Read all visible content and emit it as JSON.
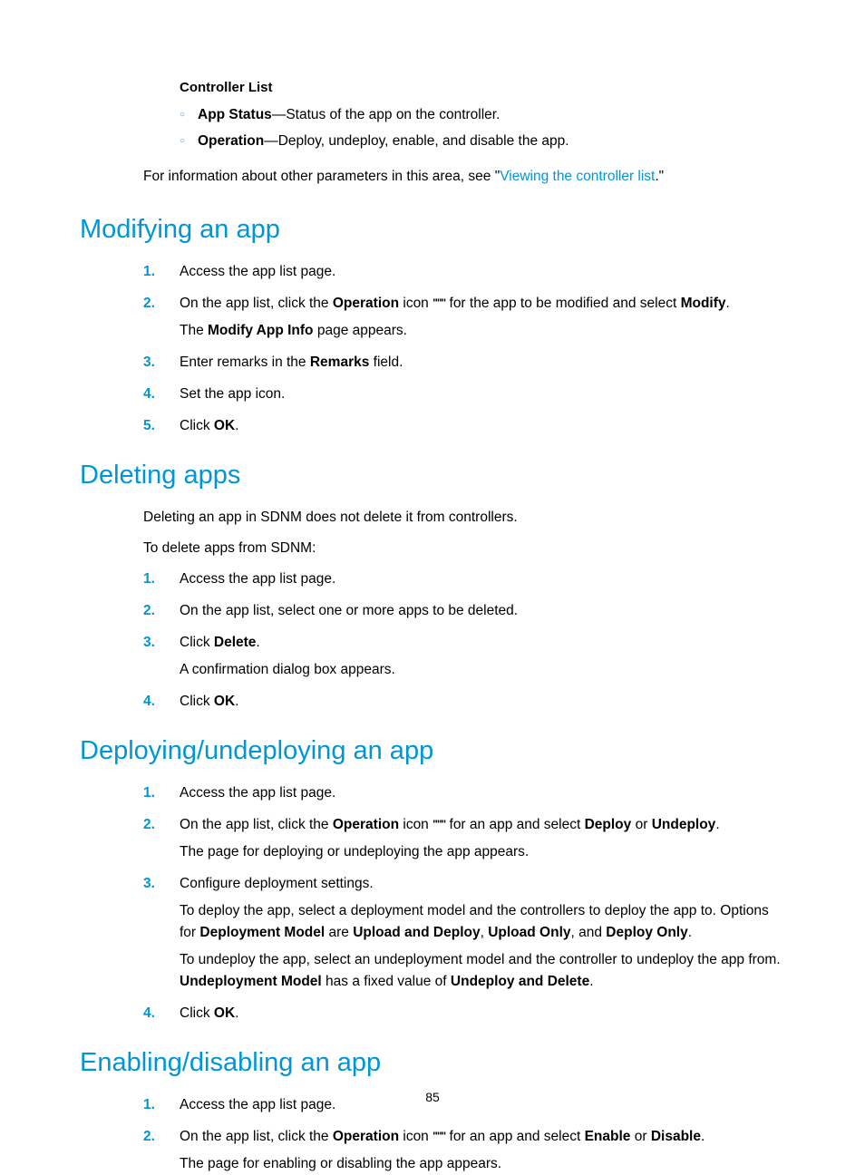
{
  "controllerList": {
    "heading": "Controller List",
    "bullets": [
      {
        "bold": "App Status",
        "rest": "—Status of the app on the controller."
      },
      {
        "bold": "Operation",
        "rest": "—Deploy, undeploy, enable, and disable the app."
      }
    ],
    "infoPrefix": "For information about other parameters in this area, see \"",
    "infoLink": "Viewing the controller list",
    "infoSuffix": ".\""
  },
  "modifying": {
    "title": "Modifying an app",
    "steps": {
      "s1": "Access the app list page.",
      "s2a": "On the app list, click the ",
      "s2b": "Operation",
      "s2c": " icon ",
      "s2d": " for the app to be modified and select ",
      "s2e": "Modify",
      "s2f": ".",
      "s2sub_a": "The ",
      "s2sub_b": "Modify App Info",
      "s2sub_c": " page appears.",
      "s3a": "Enter remarks in the ",
      "s3b": "Remarks",
      "s3c": " field.",
      "s4": "Set the app icon.",
      "s5a": "Click ",
      "s5b": "OK",
      "s5c": "."
    }
  },
  "deleting": {
    "title": "Deleting apps",
    "intro1": "Deleting an app in SDNM does not delete it from controllers.",
    "intro2": "To delete apps from SDNM:",
    "steps": {
      "s1": "Access the app list page.",
      "s2": "On the app list, select one or more apps to be deleted.",
      "s3a": "Click ",
      "s3b": "Delete",
      "s3c": ".",
      "s3sub": "A confirmation dialog box appears.",
      "s4a": "Click ",
      "s4b": "OK",
      "s4c": "."
    }
  },
  "deploying": {
    "title": "Deploying/undeploying an app",
    "steps": {
      "s1": "Access the app list page.",
      "s2a": "On the app list, click the ",
      "s2b": "Operation",
      "s2c": " icon ",
      "s2d": " for an app and select ",
      "s2e": "Deploy",
      "s2f": " or ",
      "s2g": "Undeploy",
      "s2h": ".",
      "s2sub": "The page for deploying or undeploying the app appears.",
      "s3": "Configure deployment settings.",
      "s3p1a": "To deploy the app, select a deployment model and the controllers to deploy the app to. Options for ",
      "s3p1b": "Deployment Model",
      "s3p1c": " are ",
      "s3p1d": "Upload and Deploy",
      "s3p1e": ", ",
      "s3p1f": "Upload Only",
      "s3p1g": ", and ",
      "s3p1h": "Deploy Only",
      "s3p1i": ".",
      "s3p2a": "To undeploy the app, select an undeployment model and the controller to undeploy the app from. ",
      "s3p2b": "Undeployment Model",
      "s3p2c": " has a fixed value of ",
      "s3p2d": "Undeploy and Delete",
      "s3p2e": ".",
      "s4a": "Click ",
      "s4b": "OK",
      "s4c": "."
    }
  },
  "enabling": {
    "title": "Enabling/disabling an app",
    "steps": {
      "s1": "Access the app list page.",
      "s2a": "On the app list, click the ",
      "s2b": "Operation",
      "s2c": " icon ",
      "s2d": " for an app and select ",
      "s2e": "Enable",
      "s2f": " or ",
      "s2g": "Disable",
      "s2h": ".",
      "s2sub": "The page for enabling or disabling the app appears."
    }
  },
  "numbers": {
    "n1": "1.",
    "n2": "2.",
    "n3": "3.",
    "n4": "4.",
    "n5": "5."
  },
  "iconDots": "\"\"\"",
  "pageNumber": "85"
}
